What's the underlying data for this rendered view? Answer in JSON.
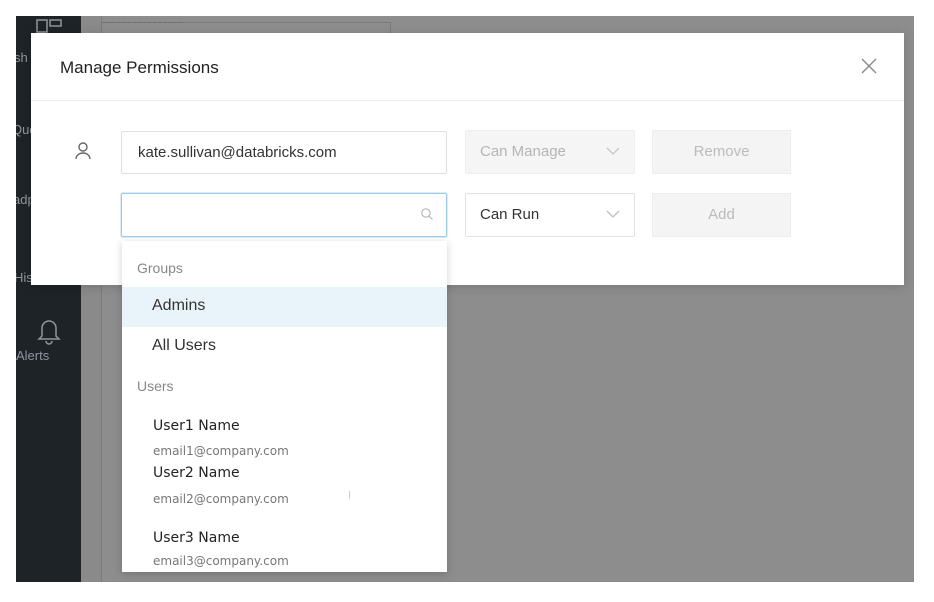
{
  "sidebar": {
    "items": [
      {
        "label": "sh",
        "icon": "dashboard-icon"
      },
      {
        "label": "Que",
        "icon": "queries-icon"
      },
      {
        "label": "adp",
        "icon": "alert-destinations-icon"
      },
      {
        "label": "History",
        "icon": "history-icon"
      },
      {
        "label": "Alerts",
        "icon": "bell-icon"
      }
    ]
  },
  "modal": {
    "title": "Manage Permissions",
    "existing_user": {
      "email": "kate.sullivan@databricks.com",
      "permission": "Can Manage",
      "remove_label": "Remove"
    },
    "new_entry": {
      "search_value": "",
      "permission": "Can Run",
      "add_label": "Add"
    }
  },
  "dropdown": {
    "groups_header": "Groups",
    "groups": [
      "Admins",
      "All Users"
    ],
    "highlighted": "Admins",
    "users_header": "Users",
    "users": [
      {
        "name": "User1 Name",
        "email": "email1@company.com"
      },
      {
        "name": "User2 Name",
        "email": "email2@company.com"
      },
      {
        "name": "User3 Name",
        "email": "email3@company.com"
      }
    ]
  },
  "colors": {
    "overlay": "#8a8a8a",
    "sidebar": "#1e2328",
    "highlight": "#e9f3fa",
    "focus_border": "#9ecbe8"
  }
}
